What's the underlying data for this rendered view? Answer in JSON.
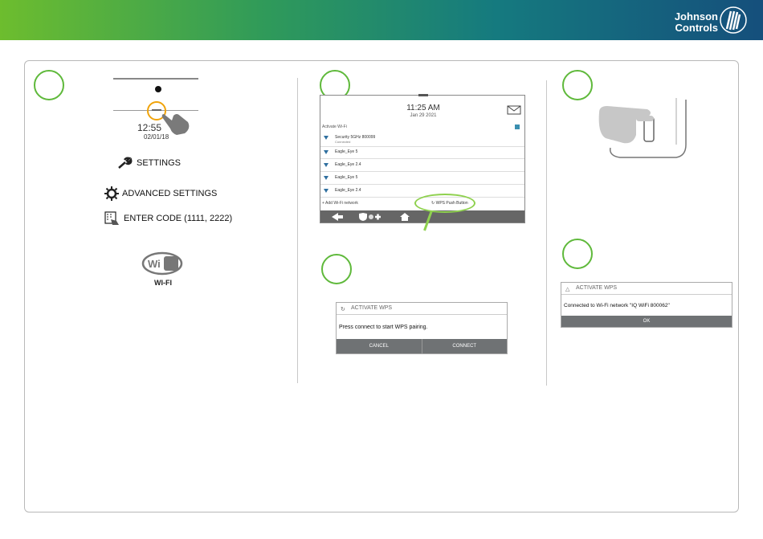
{
  "brand": {
    "line1": "Johnson",
    "line2": "Controls"
  },
  "step1": {
    "time": "12:55",
    "date": "02/01/18",
    "settings_label": "SETTINGS",
    "advanced_label": "ADVANCED SETTINGS",
    "enter_code_label": "ENTER CODE (1111, 2222)",
    "wifi_logo_text": "Wi Fi",
    "wifi_label": "WI-FI"
  },
  "step2": {
    "time": "11:25 AM",
    "date": "Jan 29 2021",
    "activate_label": "Activate Wi-Fi",
    "networks": [
      {
        "name": "Security 5GHz 800099",
        "status": "Connected"
      },
      {
        "name": "Eagle_Eye 5",
        "status": ""
      },
      {
        "name": "Eagle_Eye 2.4",
        "status": ""
      },
      {
        "name": "Eagle_Eye 5",
        "status": ""
      },
      {
        "name": "Eagle_Eye 2.4",
        "status": ""
      }
    ],
    "add_network": "+ Add Wi-Fi network",
    "wps_button": "WPS Push Button"
  },
  "wps_dialog": {
    "title": "ACTIVATE WPS",
    "message": "Press connect to start WPS pairing.",
    "cancel": "CANCEL",
    "connect": "CONNECT"
  },
  "result_dialog": {
    "title": "ACTIVATE WPS",
    "message": "Connected to Wi-Fi network \"IQ WiFi 800062\"",
    "ok": "OK"
  },
  "colors": {
    "accent_green": "#5fb93b",
    "highlight_orange": "#f0a30a",
    "button_bar": "#6f7274"
  }
}
